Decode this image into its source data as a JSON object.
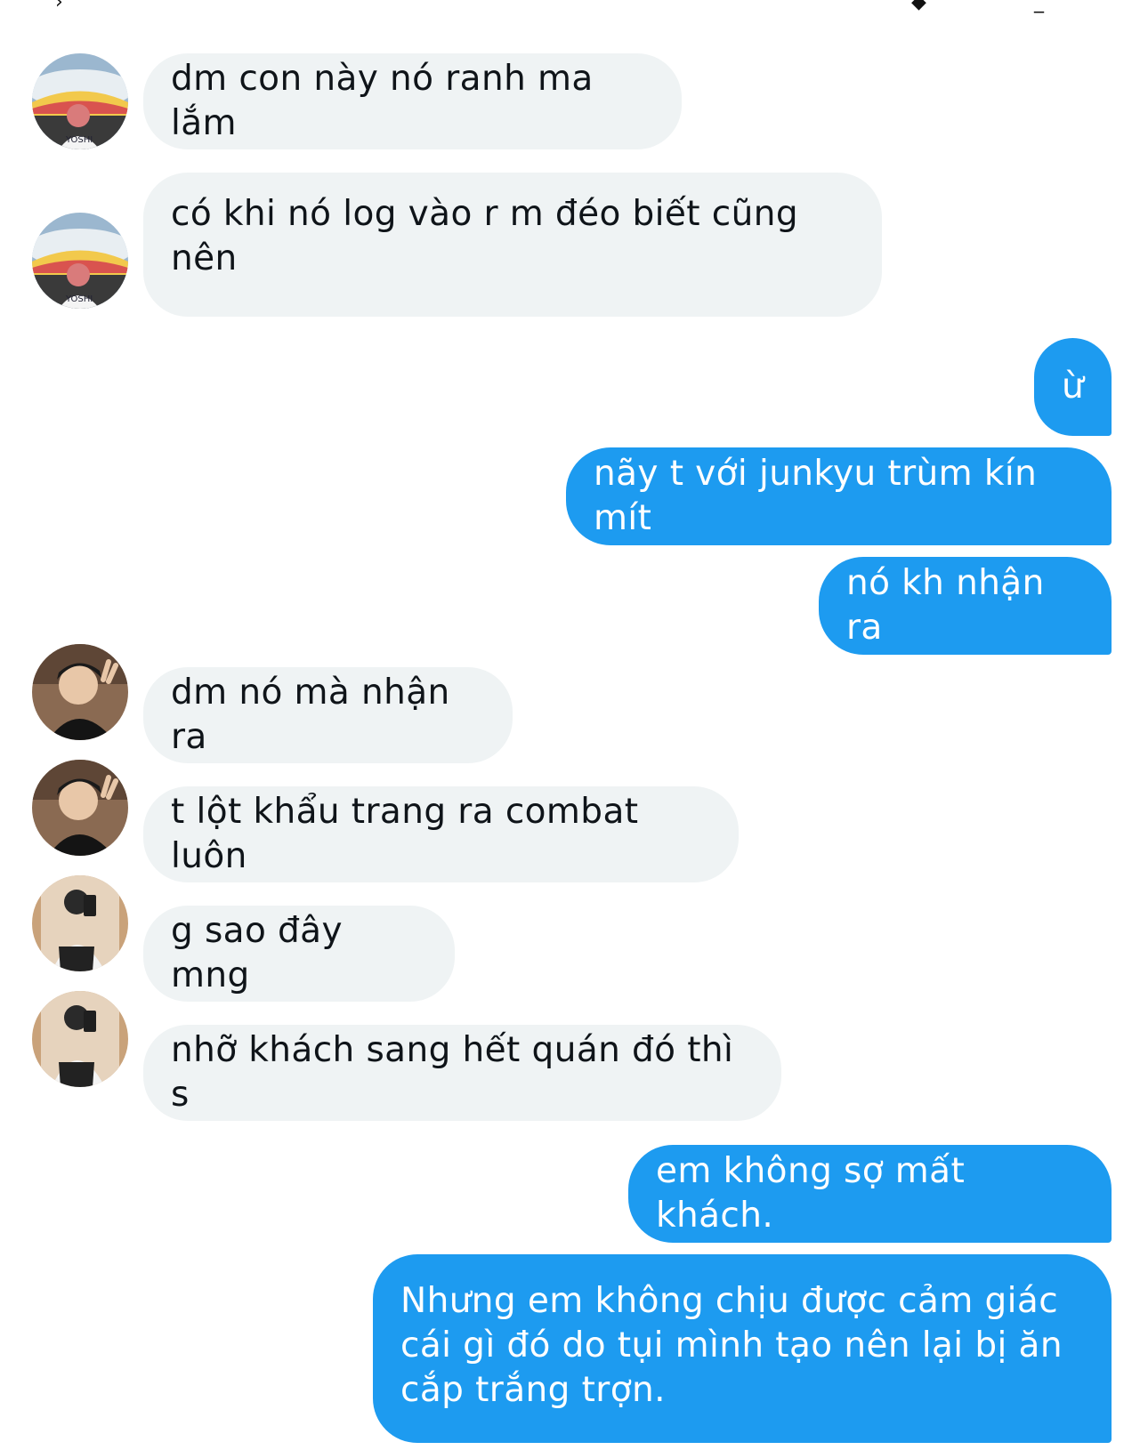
{
  "conversation": {
    "messages": [
      {
        "id": "m1",
        "direction": "incoming",
        "sender_avatar": "avatar-stadium",
        "text": "dm con này nó ranh ma lắm"
      },
      {
        "id": "m2",
        "direction": "incoming",
        "sender_avatar": "avatar-stadium",
        "text": "có khi nó log vào r m đéo biết cũng\nnên"
      },
      {
        "id": "m3",
        "direction": "outgoing",
        "text": "ừ"
      },
      {
        "id": "m4",
        "direction": "outgoing",
        "text": "nãy t với junkyu trùm kín mít"
      },
      {
        "id": "m5",
        "direction": "outgoing",
        "text": "nó kh nhận ra"
      },
      {
        "id": "m6",
        "direction": "incoming",
        "sender_avatar": "avatar-peace-sign",
        "text": "dm nó mà nhận ra"
      },
      {
        "id": "m7",
        "direction": "incoming",
        "sender_avatar": "avatar-peace-sign",
        "text": "t lột khẩu trang ra combat luôn"
      },
      {
        "id": "m8",
        "direction": "incoming",
        "sender_avatar": "avatar-mirror-selfie",
        "text": "g sao đây mng"
      },
      {
        "id": "m9",
        "direction": "incoming",
        "sender_avatar": "avatar-mirror-selfie",
        "text": "nhỡ khách sang hết quán đó thì s"
      },
      {
        "id": "m10",
        "direction": "outgoing",
        "text": "em không sợ mất khách."
      },
      {
        "id": "m11",
        "direction": "outgoing",
        "text": "Nhưng em không chịu được cảm giác\ncái gì đó do tụi mình tạo nên lại bị ăn\ncắp trắng trợn."
      }
    ]
  },
  "colors": {
    "incoming_bubble": "#eff3f4",
    "incoming_text": "#0f1419",
    "outgoing_bubble": "#1d9bf0",
    "outgoing_text": "#ffffff"
  }
}
